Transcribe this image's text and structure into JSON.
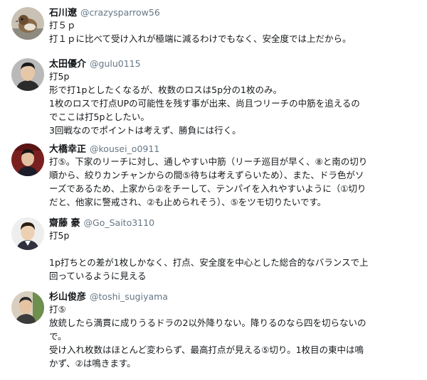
{
  "tweets": [
    {
      "name": "石川遼",
      "handle": "@crazysparrow56",
      "lines": [
        "打５ｐ",
        "打１ｐに比べて受け入れが極端に減るわけでもなく、安全度では上だから。"
      ]
    },
    {
      "name": "太田優介",
      "handle": "@gulu0115",
      "lines": [
        "打5p",
        "形で打1pとしたくなるが、枚数のロスは5p分の1枚のみ。",
        "1枚のロスで打点UPの可能性を残す事が出来、尚且つリーチの中筋を追えるの",
        "でここは打5pとしたい。",
        "3回戦なのでポイントは考えず、勝負には行く。"
      ]
    },
    {
      "name": "大橋幸正",
      "handle": "@kousei_o0911",
      "lines": [
        "打⑤。下家のリーチに対し、通しやすい中筋（リーチ巡目が早く、⑧と南の切り",
        "順から、絞りカンチャンからの間⑤待ちは考えずらいため）、また、ドラ色がソ",
        "ーズであるため、上家から②をチーして、テンパイを入れやすいように（①切り",
        "だと、他家に警戒され、②も止められそう）、⑤をツモ切りたいです。"
      ]
    },
    {
      "name": "齋藤 豪",
      "handle": "@Go_Saito3110",
      "lines": [
        "打5p",
        "",
        "1p打ちとの差が1枚しかなく、打点、安全度を中心とした総合的なバランスで上",
        "回っているように見える"
      ]
    },
    {
      "name": "杉山俊彦",
      "handle": "@toshi_sugiyama",
      "lines": [
        "打⑤",
        "放銃したら満貫に成りうるドラの2以外降りない。降りるのなら四を切らないの",
        "で。",
        "受け入れ枚数はほとんど変わらず、最高打点が見える⑤切り。1枚目の東中は鳴",
        "かず、②は鳴きます。"
      ]
    }
  ]
}
